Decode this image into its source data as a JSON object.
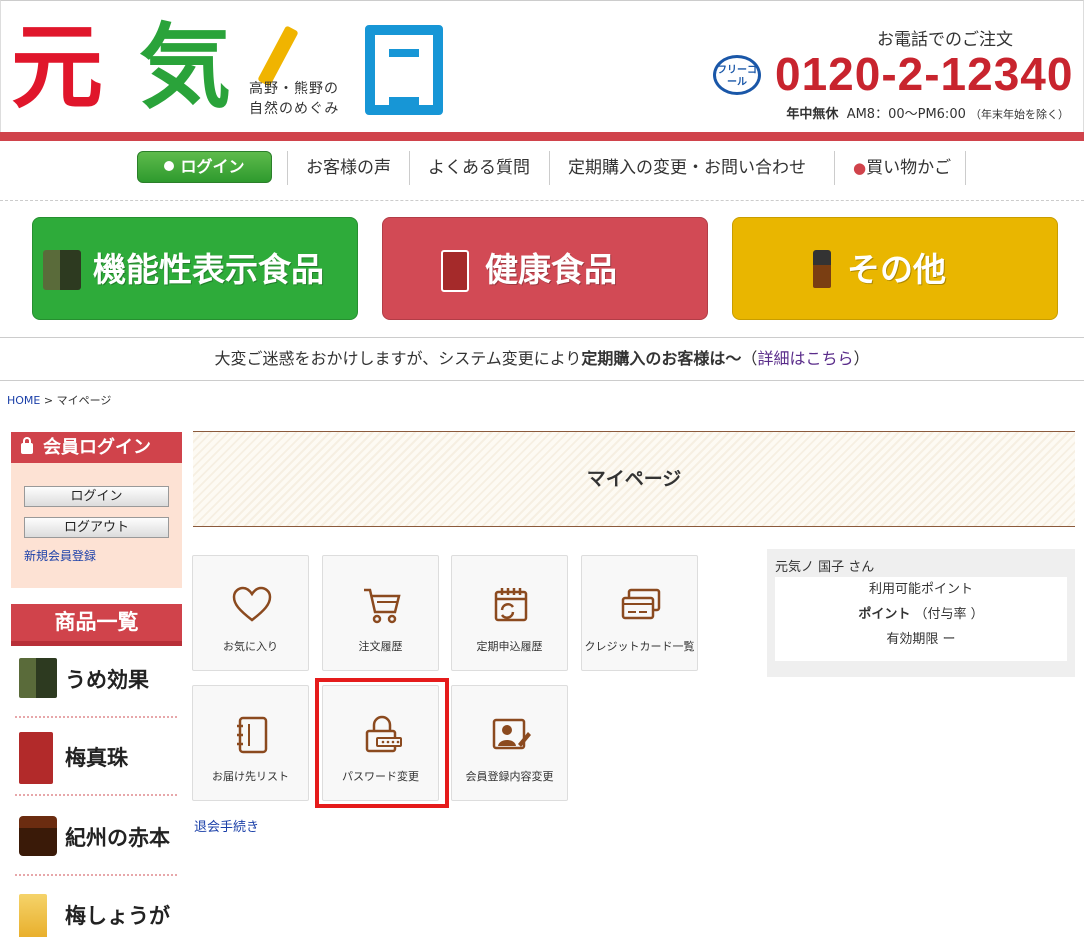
{
  "header": {
    "logo_subtitle_line1": "高野・熊野の",
    "logo_subtitle_line2": "自然のめぐみ",
    "logo_chars": [
      "元",
      "気",
      "ノ",
      "国"
    ],
    "tel_label": "お電話でのご注文",
    "free_call_label": "フリーコール",
    "tel_number": "0120-2-12340",
    "hours_bold": "年中無休",
    "hours_time": "AM8：00〜PM6:00",
    "hours_note": "（年末年始を除く）"
  },
  "nav": {
    "login_label": "ログイン",
    "items": [
      {
        "label": "お客様の声"
      },
      {
        "label": "よくある質問"
      },
      {
        "label": "定期購入の変更・お問い合わせ"
      },
      {
        "label": "買い物かご"
      }
    ]
  },
  "categories": [
    {
      "label": "機能性表示食品",
      "color": "#2eab3a"
    },
    {
      "label": "健康食品",
      "color": "#d24a55"
    },
    {
      "label": "その他",
      "color": "#e9b600"
    }
  ],
  "notice": {
    "text": "大変ご迷惑をおかけしますが、システム変更により",
    "bold": "定期購入のお客様は〜",
    "link_open": "（",
    "link": "詳細はこちら",
    "link_close": "）"
  },
  "breadcrumb": {
    "home": "HOME",
    "separator": ">",
    "current": "マイページ"
  },
  "sidebar": {
    "login_title": "会員ログイン",
    "login_button": "ログイン",
    "logout_button": "ログアウト",
    "register_link": "新規会員登録",
    "products_title": "商品一覧",
    "products": [
      {
        "name": "うめ効果"
      },
      {
        "name": "梅真珠"
      },
      {
        "name": "紀州の赤本"
      },
      {
        "name": "梅しょうが"
      }
    ]
  },
  "main": {
    "title": "マイページ",
    "tiles": [
      {
        "label": "お気に入り",
        "icon": "heart-icon"
      },
      {
        "label": "注文履歴",
        "icon": "cart-icon"
      },
      {
        "label": "定期申込履歴",
        "icon": "calendar-icon"
      },
      {
        "label": "クレジットカード一覧",
        "icon": "credit-card-icon"
      },
      {
        "label": "お届け先リスト",
        "icon": "address-book-icon"
      },
      {
        "label": "パスワード変更",
        "icon": "lock-password-icon"
      },
      {
        "label": "会員登録内容変更",
        "icon": "profile-edit-icon"
      }
    ],
    "withdraw_link": "退会手続き"
  },
  "points": {
    "user": "元気ノ 国子 さん",
    "available_label": "利用可能ポイント",
    "point_bold": "ポイント",
    "rate": "（付与率 ）",
    "expiry": "有効期限 ー"
  },
  "colors": {
    "brand_red": "#d0434b",
    "icon_brown": "#8b4a1f",
    "highlight": "#e51b1b"
  }
}
